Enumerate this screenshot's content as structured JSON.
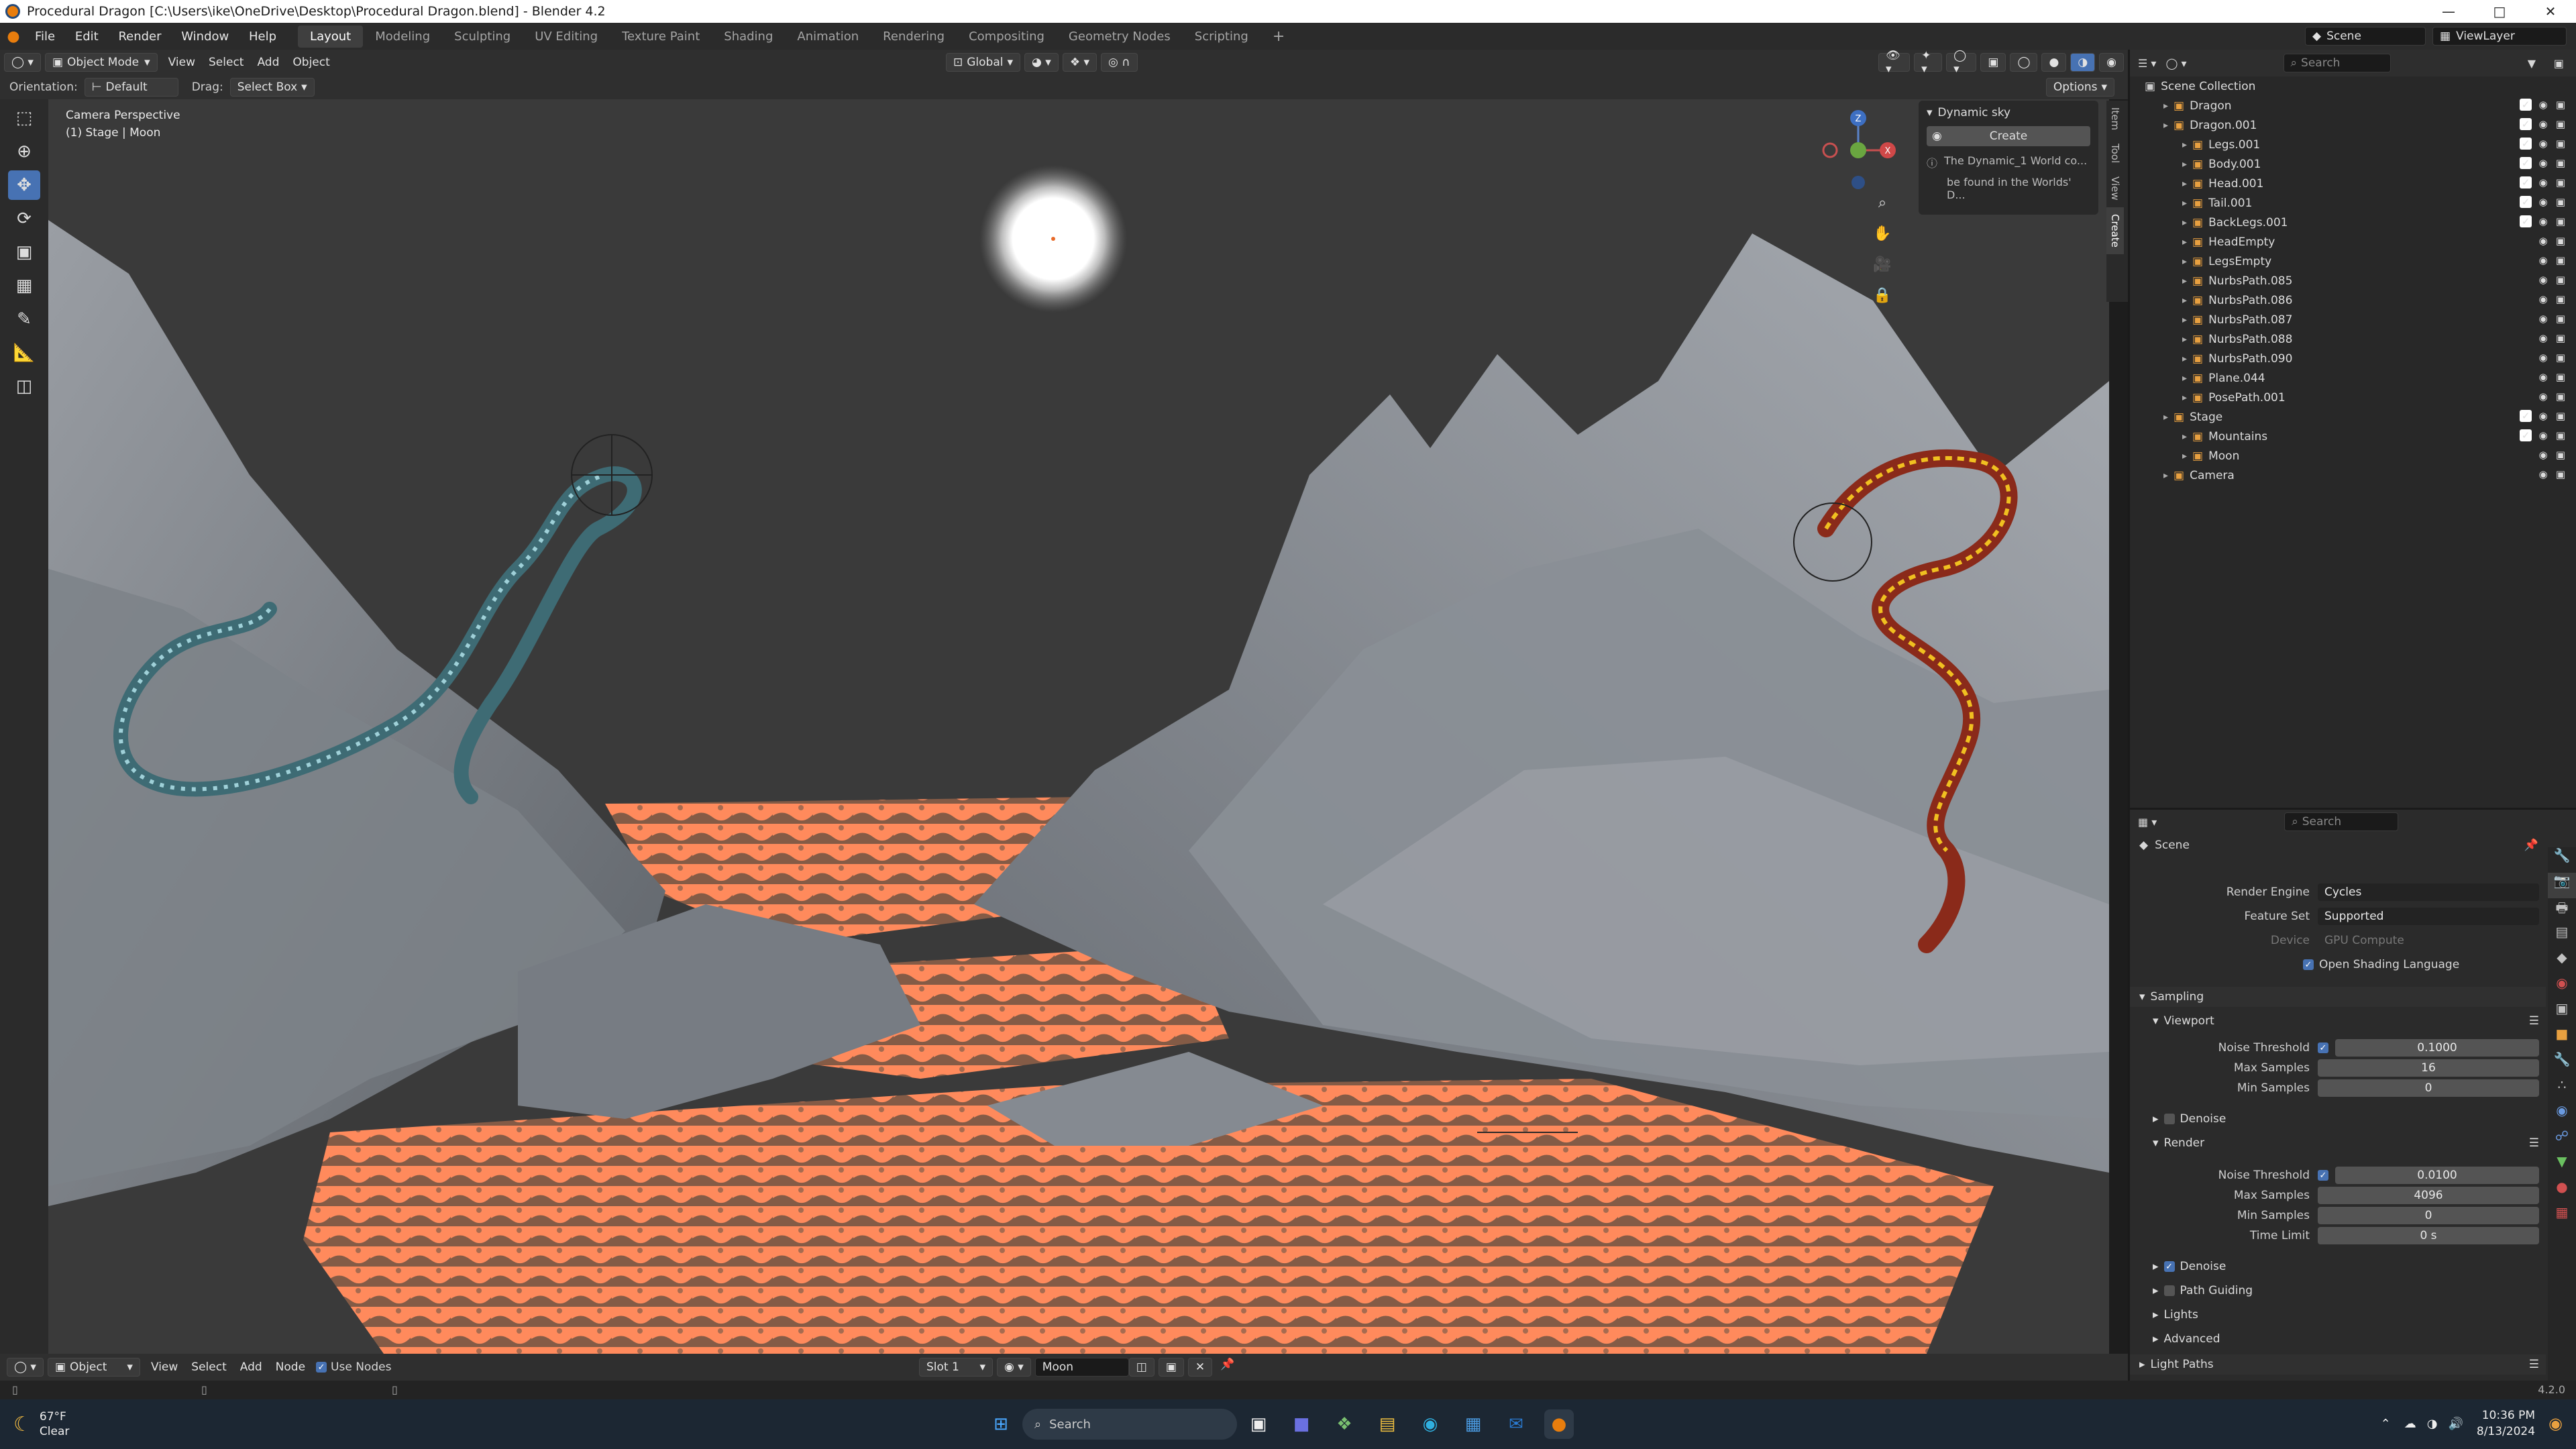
{
  "window": {
    "title": "Procedural Dragon [C:\\Users\\ike\\OneDrive\\Desktop\\Procedural Dragon.blend] - Blender 4.2"
  },
  "menu": [
    "File",
    "Edit",
    "Render",
    "Window",
    "Help"
  ],
  "workspaces": [
    "Layout",
    "Modeling",
    "Sculpting",
    "UV Editing",
    "Texture Paint",
    "Shading",
    "Animation",
    "Rendering",
    "Compositing",
    "Geometry Nodes",
    "Scripting"
  ],
  "topright": {
    "scene": "Scene",
    "viewlayer": "ViewLayer"
  },
  "header": {
    "mode": "Object Mode",
    "view": "View",
    "select": "Select",
    "add": "Add",
    "object": "Object",
    "transform": "Global",
    "orientation_label": "Orientation:",
    "orientation_value": "Default",
    "drag_label": "Drag:",
    "drag_value": "Select Box",
    "options": "Options"
  },
  "viewport": {
    "camera_label": "Camera Perspective",
    "collection_label": "(1) Stage | Moon"
  },
  "npanel": {
    "title": "Dynamic sky",
    "create": "Create",
    "info1": "The Dynamic_1 World co...",
    "info2": "be found in the Worlds' D...",
    "tabs": [
      "Item",
      "Tool",
      "View",
      "Create"
    ]
  },
  "outliner": {
    "search_placeholder": "Search",
    "root": "Scene Collection",
    "rows": [
      {
        "name": "Dragon",
        "indent": 1,
        "check": true
      },
      {
        "name": "Dragon.001",
        "indent": 1,
        "check": true
      },
      {
        "name": "Legs.001",
        "indent": 2,
        "check": true
      },
      {
        "name": "Body.001",
        "indent": 2,
        "check": true
      },
      {
        "name": "Head.001",
        "indent": 2,
        "check": true
      },
      {
        "name": "Tail.001",
        "indent": 2,
        "check": true
      },
      {
        "name": "BackLegs.001",
        "indent": 2,
        "check": true
      },
      {
        "name": "HeadEmpty",
        "indent": 2,
        "check": false
      },
      {
        "name": "LegsEmpty",
        "indent": 2,
        "check": false
      },
      {
        "name": "NurbsPath.085",
        "indent": 2,
        "check": false
      },
      {
        "name": "NurbsPath.086",
        "indent": 2,
        "check": false
      },
      {
        "name": "NurbsPath.087",
        "indent": 2,
        "check": false
      },
      {
        "name": "NurbsPath.088",
        "indent": 2,
        "check": false
      },
      {
        "name": "NurbsPath.090",
        "indent": 2,
        "check": false
      },
      {
        "name": "Plane.044",
        "indent": 2,
        "check": false
      },
      {
        "name": "PosePath.001",
        "indent": 2,
        "check": false
      },
      {
        "name": "Stage",
        "indent": 1,
        "check": true
      },
      {
        "name": "Mountains",
        "indent": 2,
        "check": true
      },
      {
        "name": "Moon",
        "indent": 2,
        "check": false
      },
      {
        "name": "Camera",
        "indent": 1,
        "check": false
      }
    ]
  },
  "properties": {
    "search_placeholder": "Search",
    "context": "Scene",
    "render_engine_label": "Render Engine",
    "render_engine": "Cycles",
    "feature_set_label": "Feature Set",
    "feature_set": "Supported",
    "device_label": "Device",
    "device": "GPU Compute",
    "osl": "Open Shading Language",
    "sampling": "Sampling",
    "viewport": "Viewport",
    "noise_threshold_label": "Noise Threshold",
    "vp_noise": "0.1000",
    "max_samples_label": "Max Samples",
    "vp_max": "16",
    "min_samples_label": "Min Samples",
    "vp_min": "0",
    "denoise": "Denoise",
    "render": "Render",
    "r_noise": "0.0100",
    "r_max": "4096",
    "r_min": "0",
    "time_limit_label": "Time Limit",
    "r_time": "0 s",
    "path_guiding": "Path Guiding",
    "lights": "Lights",
    "advanced": "Advanced",
    "light_paths": "Light Paths"
  },
  "statusbar": {
    "editor": "Object",
    "view": "View",
    "select": "Select",
    "add": "Add",
    "node": "Node",
    "use_nodes": "Use Nodes",
    "slot": "Slot 1",
    "material": "Moon"
  },
  "version": "4.2.0",
  "taskbar": {
    "weather_temp": "67°F",
    "weather_desc": "Clear",
    "search": "Search",
    "time": "10:36 PM",
    "date": "8/13/2024"
  }
}
